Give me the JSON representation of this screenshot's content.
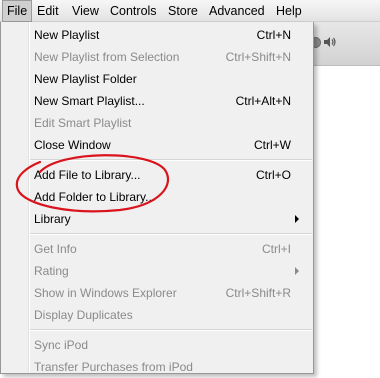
{
  "menubar": {
    "items": [
      {
        "label": "File"
      },
      {
        "label": "Edit"
      },
      {
        "label": "View"
      },
      {
        "label": "Controls"
      },
      {
        "label": "Store"
      },
      {
        "label": "Advanced"
      },
      {
        "label": "Help"
      }
    ]
  },
  "file_menu": {
    "items": [
      {
        "label": "New Playlist",
        "shortcut": "Ctrl+N",
        "enabled": true
      },
      {
        "label": "New Playlist from Selection",
        "shortcut": "Ctrl+Shift+N",
        "enabled": false
      },
      {
        "label": "New Playlist Folder",
        "shortcut": "",
        "enabled": true
      },
      {
        "label": "New Smart Playlist...",
        "shortcut": "Ctrl+Alt+N",
        "enabled": true
      },
      {
        "label": "Edit Smart Playlist",
        "shortcut": "",
        "enabled": false
      },
      {
        "label": "Close Window",
        "shortcut": "Ctrl+W",
        "enabled": true
      },
      {
        "label": "Add File to Library...",
        "shortcut": "Ctrl+O",
        "enabled": true
      },
      {
        "label": "Add Folder to Library...",
        "shortcut": "",
        "enabled": true
      },
      {
        "label": "Library",
        "shortcut": "",
        "enabled": true,
        "submenu": true
      },
      {
        "label": "Get Info",
        "shortcut": "Ctrl+I",
        "enabled": false
      },
      {
        "label": "Rating",
        "shortcut": "",
        "enabled": false,
        "submenu": true
      },
      {
        "label": "Show in Windows Explorer",
        "shortcut": "Ctrl+Shift+R",
        "enabled": false
      },
      {
        "label": "Display Duplicates",
        "shortcut": "",
        "enabled": false
      },
      {
        "label": "Sync iPod",
        "shortcut": "",
        "enabled": false
      },
      {
        "label": "Transfer Purchases from iPod",
        "shortcut": "",
        "enabled": false
      }
    ]
  },
  "annotation": {
    "color": "#d9141c"
  }
}
